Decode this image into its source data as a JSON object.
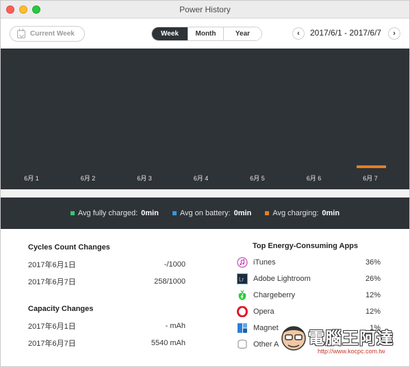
{
  "window": {
    "title": "Power History"
  },
  "toolbar": {
    "current_week_label": "Current Week",
    "tabs": [
      {
        "label": "Week",
        "active": true
      },
      {
        "label": "Month",
        "active": false
      },
      {
        "label": "Year",
        "active": false
      }
    ],
    "prev_glyph": "‹",
    "next_glyph": "›",
    "date_range": "2017/6/1 - 2017/6/7"
  },
  "chart_data": {
    "type": "bar",
    "categories": [
      "6月 1",
      "6月 2",
      "6月 3",
      "6月 4",
      "6月 5",
      "6月 6",
      "6月 7"
    ],
    "series": [
      {
        "name": "Avg fully charged",
        "color": "#2ecc71",
        "values": [
          0,
          0,
          0,
          0,
          0,
          0,
          0
        ]
      },
      {
        "name": "Avg on battery",
        "color": "#3498db",
        "values": [
          0,
          0,
          0,
          0,
          0,
          0,
          0
        ]
      },
      {
        "name": "Avg charging",
        "color": "#e67e22",
        "values": [
          0,
          0,
          0,
          0,
          0,
          0,
          0
        ]
      }
    ],
    "marker": {
      "category": "6月 7",
      "color": "#e67e22"
    },
    "background": "#2e3338"
  },
  "legend": [
    {
      "label": "Avg fully charged:",
      "value": "0min",
      "color": "#2ecc71"
    },
    {
      "label": "Avg on battery:",
      "value": "0min",
      "color": "#3498db"
    },
    {
      "label": "Avg charging:",
      "value": "0min",
      "color": "#e67e22"
    }
  ],
  "cycles": {
    "title": "Cycles Count Changes",
    "rows": [
      {
        "date": "2017年6月1日",
        "value": "-/1000"
      },
      {
        "date": "2017年6月7日",
        "value": "258/1000"
      }
    ]
  },
  "capacity": {
    "title": "Capacity Changes",
    "rows": [
      {
        "date": "2017年6月1日",
        "value": "- mAh"
      },
      {
        "date": "2017年6月7日",
        "value": "5540 mAh"
      }
    ]
  },
  "apps": {
    "title": "Top Energy-Consuming Apps",
    "items": [
      {
        "name": "iTunes",
        "pct": "36%",
        "icon": "itunes-icon"
      },
      {
        "name": "Adobe Lightroom",
        "pct": "26%",
        "icon": "lightroom-icon"
      },
      {
        "name": "Chargeberry",
        "pct": "12%",
        "icon": "chargeberry-icon"
      },
      {
        "name": "Opera",
        "pct": "12%",
        "icon": "opera-icon"
      },
      {
        "name": "Magnet",
        "pct": "1%",
        "icon": "magnet-icon"
      },
      {
        "name": "Other A",
        "pct": "",
        "icon": "other-apps-icon"
      }
    ]
  },
  "watermark": {
    "text": "電腦王阿達",
    "url": "http://www.kocpc.com.tw"
  }
}
